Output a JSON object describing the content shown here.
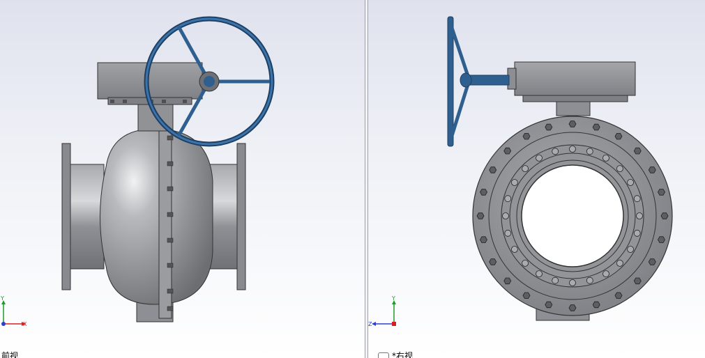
{
  "viewports": {
    "left": {
      "label": "前视",
      "axes": {
        "x": "X",
        "y": "Y"
      }
    },
    "right": {
      "label": "*右视",
      "axes": {
        "z": "Z",
        "y": "Y"
      }
    }
  },
  "colors": {
    "body_metal": "#8f9196",
    "body_highlight": "#e8e8ea",
    "handwheel": "#2f5f8f",
    "handwheel_dark": "#1d3f63",
    "axis_x": "#d62020",
    "axis_y": "#1f9b2d",
    "axis_z": "#2a3fd0"
  },
  "icons": [
    "camera-icon",
    "axis-triad-icon"
  ]
}
